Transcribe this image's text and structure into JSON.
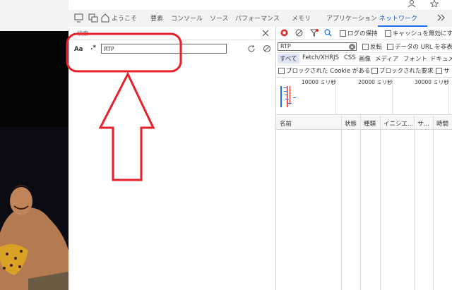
{
  "devtools": {
    "tabs": [
      "ようこそ",
      "要素",
      "コンソール",
      "ソース",
      "パフォーマンス",
      "メモリ",
      "アプリケーション",
      "ネットワーク"
    ],
    "active_tab": "ネットワーク"
  },
  "search": {
    "title": "検索",
    "match_case": "Aa",
    "regex": ".*",
    "query": "RTP"
  },
  "network": {
    "preserve_log": "ログの保持",
    "disable_cache": "キャッシュを無効にす",
    "filter_value": "RTP",
    "invert": "反転",
    "hide_data_urls": "データの URL を非表示",
    "type_filters": [
      "すべて",
      "Fetch/XHR",
      "JS",
      "CSS",
      "画像",
      "メディア",
      "フォント",
      "ドキュメ"
    ],
    "blocked_cookies": "ブロックされた Cookie がある",
    "blocked_requests": "ブロックされた要求",
    "third_party": "サ",
    "timeline_ticks": [
      "10000 ミリ秒",
      "20000 ミリ秒",
      "30000 ミリ秒"
    ],
    "columns": [
      "名前",
      "状態",
      "種類",
      "イニシエ...",
      "サ...",
      "時間"
    ]
  },
  "colors": {
    "annotation": "#e8202a",
    "accent": "#1a73e8",
    "record": "#d93025"
  }
}
